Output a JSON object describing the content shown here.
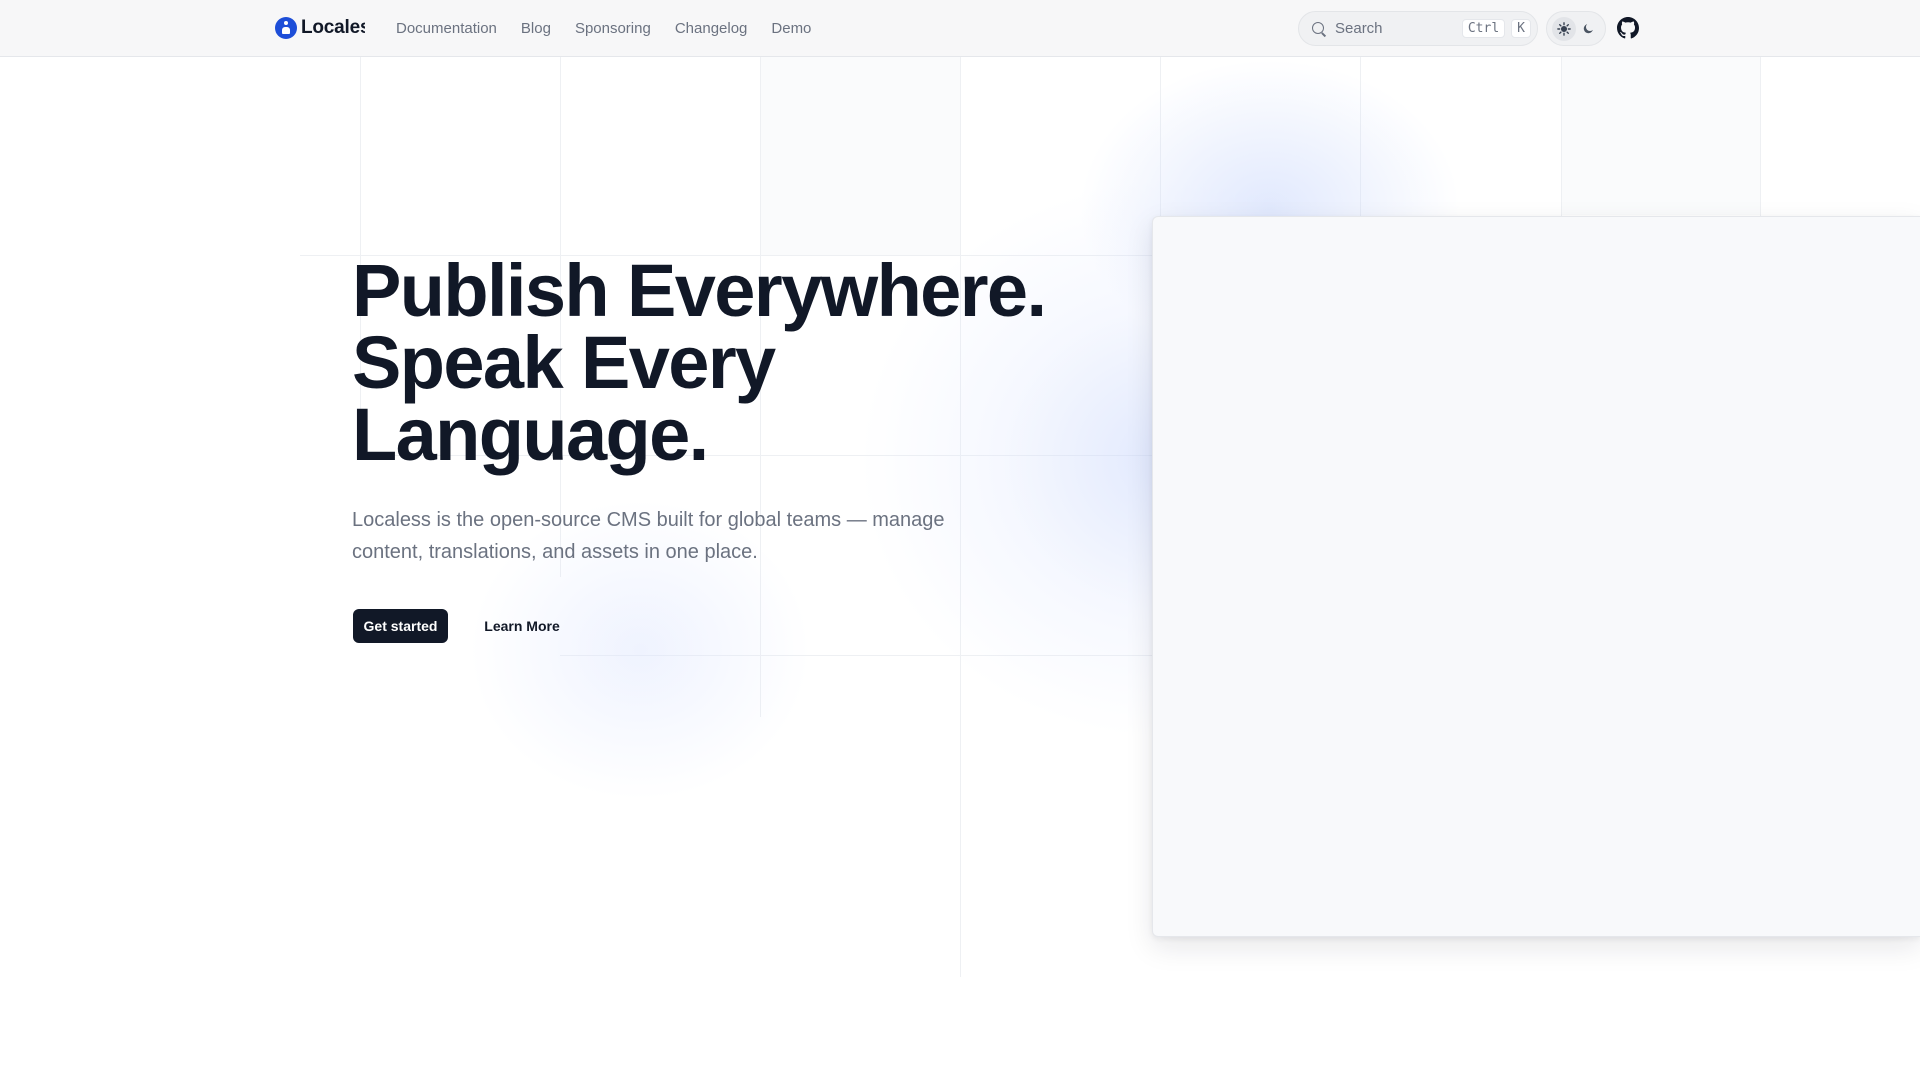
{
  "header": {
    "brand": "Localess",
    "nav": [
      "Documentation",
      "Blog",
      "Sponsoring",
      "Changelog",
      "Demo"
    ],
    "search": {
      "placeholder": "Search",
      "shortcut_modifier": "Ctrl",
      "shortcut_key": "K"
    },
    "theme_toggle": {
      "options": [
        "sun-icon",
        "moon-icon"
      ],
      "active": "light"
    },
    "github_icon": "github-icon"
  },
  "hero": {
    "title": "Publish Everywhere. Speak Every Language.",
    "subtitle": "Localess is the open-source CMS built for global teams — manage content, translations, and assets in one place.",
    "primary_cta": "Get started",
    "secondary_cta": "Learn More"
  },
  "colors": {
    "brand": "#1d4ed8",
    "text": "#111827",
    "muted": "#6b7280",
    "primary_button": "#111827",
    "glow": "#dbe4fe"
  }
}
